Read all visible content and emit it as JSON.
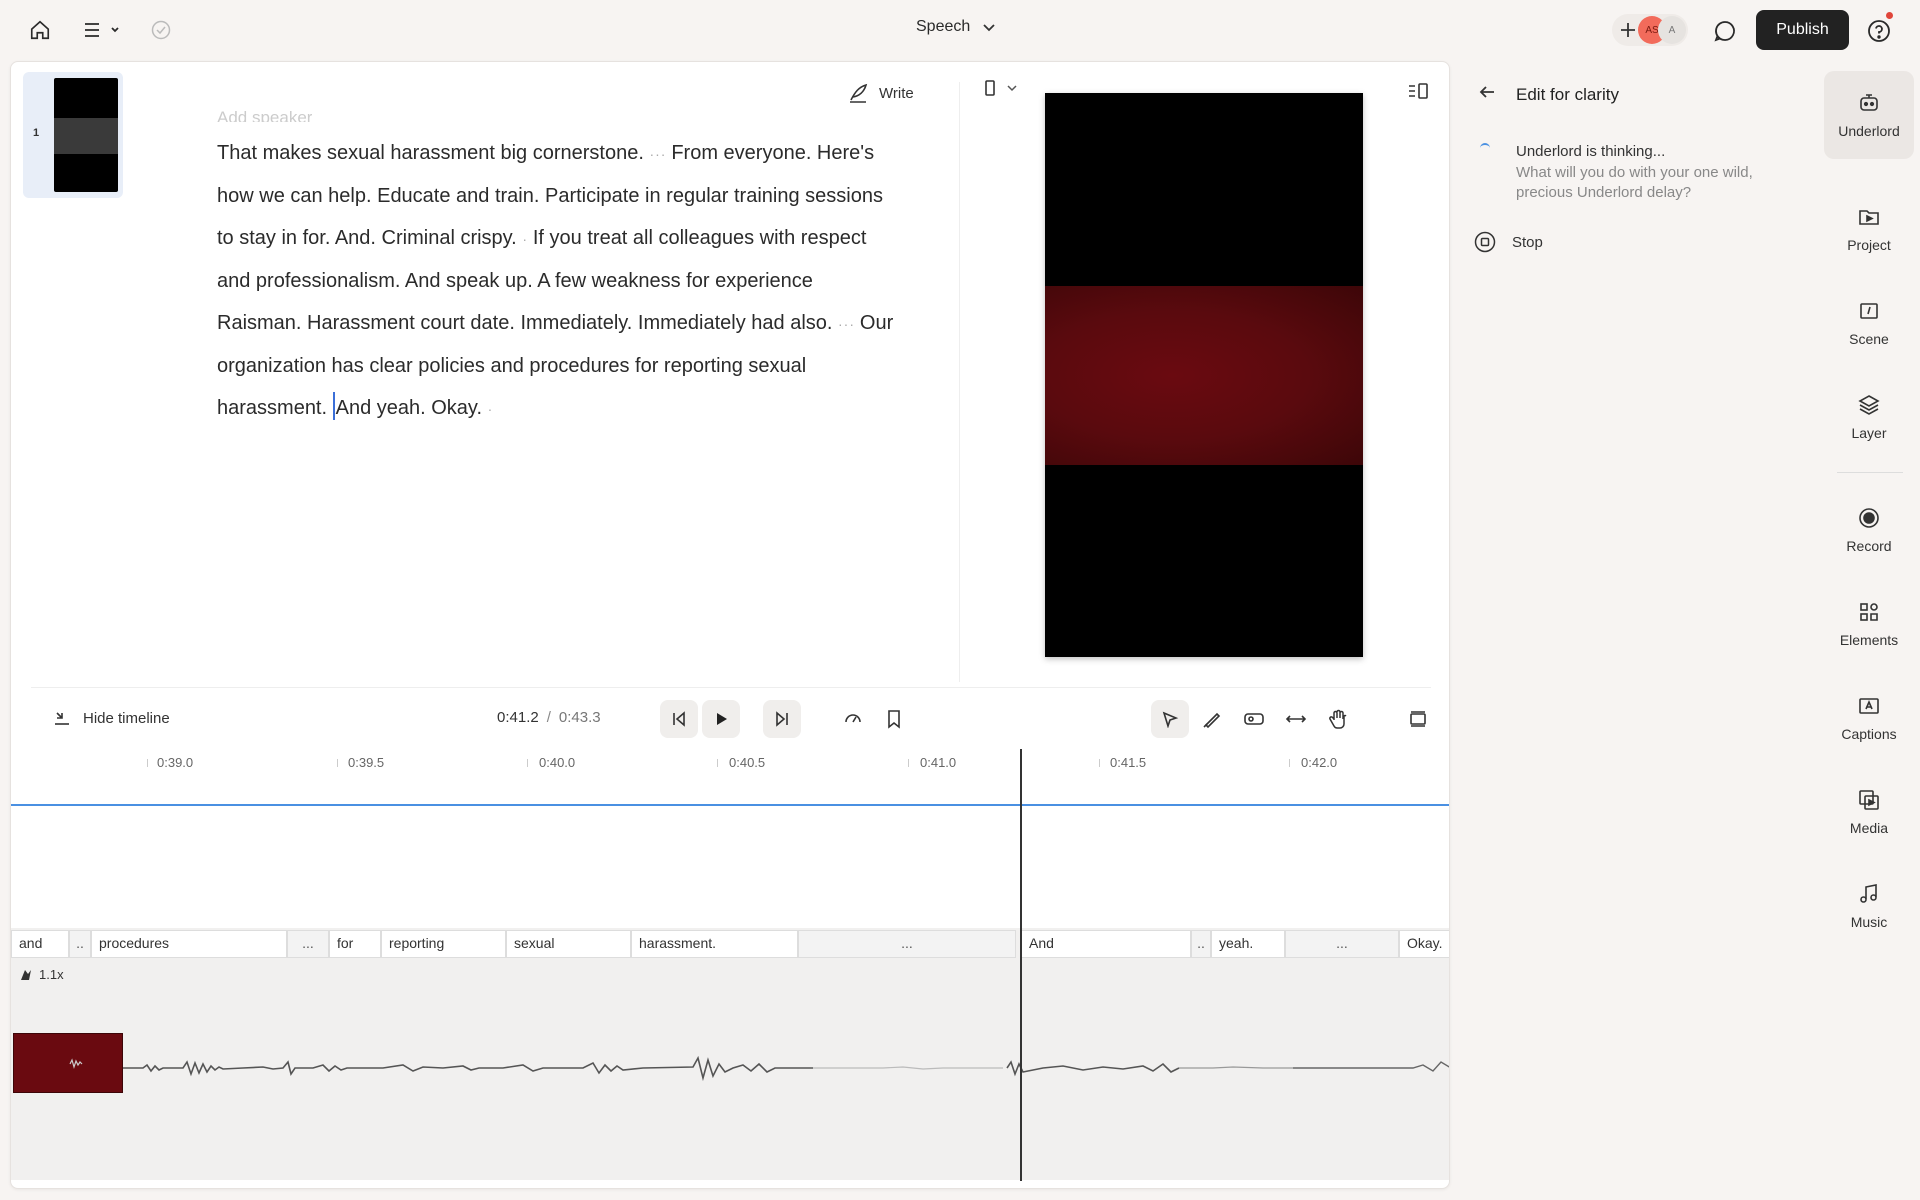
{
  "topbar": {
    "project_name": "Speech",
    "avatars": [
      "AS",
      "A"
    ],
    "publish_label": "Publish"
  },
  "editor": {
    "scene_number": "1",
    "write_label": "Write",
    "speaker_placeholder": "Add speaker",
    "transcript": {
      "s1": "That makes sexual harassment big cornerstone.",
      "s2": "From everyone. Here's how we can help. Educate and train. Participate in regular training sessions to stay in for. And.",
      "s3": "Criminal crispy.",
      "s4": "If you treat all colleagues with respect and professionalism. And speak up. A few weakness for experience Raisman. Harassment court date. Immediately. Immediately had also.",
      "s5": "Our organization has clear policies and procedures for reporting sexual harassment.",
      "s6": "And yeah. Okay."
    }
  },
  "transport": {
    "hide_timeline_label": "Hide timeline",
    "current_time": "0:41.2",
    "separator": "/",
    "duration": "0:43.3"
  },
  "timeline": {
    "ruler": [
      "0:39.0",
      "0:39.5",
      "0:40.0",
      "0:40.5",
      "0:41.0",
      "0:41.5",
      "0:42.0"
    ],
    "speed_label": "1.1x",
    "words": [
      "and",
      "..",
      "procedures",
      "...",
      "for",
      "reporting",
      "sexual",
      "harassment.",
      "...",
      "And",
      "..",
      "yeah.",
      "...",
      "Okay."
    ]
  },
  "ai_panel": {
    "title": "Edit for clarity",
    "thinking": "Underlord is thinking...",
    "subtext": "What will you do with your one wild, precious Underlord delay?",
    "stop_label": "Stop"
  },
  "sidebar": {
    "items": [
      "Underlord",
      "Project",
      "Scene",
      "Layer",
      "Record",
      "Elements",
      "Captions",
      "Media",
      "Music"
    ]
  },
  "colors": {
    "accent": "#4a90e2",
    "publish_bg": "#222222",
    "avatar_as": "#f26b5b",
    "clip_red": "#6a0a10"
  },
  "icons": [
    "home-icon",
    "menu-icon",
    "saved-check-icon",
    "chevron-down-icon",
    "plus-icon",
    "comment-icon",
    "help-icon",
    "write-icon",
    "back-arrow-icon",
    "stop-icon",
    "play-icon",
    "skip-back-icon",
    "skip-forward-icon",
    "loop-icon",
    "bookmark-icon",
    "select-tool-icon",
    "blade-tool-icon",
    "ripple-tool-icon",
    "stretch-tool-icon",
    "hand-tool-icon",
    "layout-icon"
  ]
}
